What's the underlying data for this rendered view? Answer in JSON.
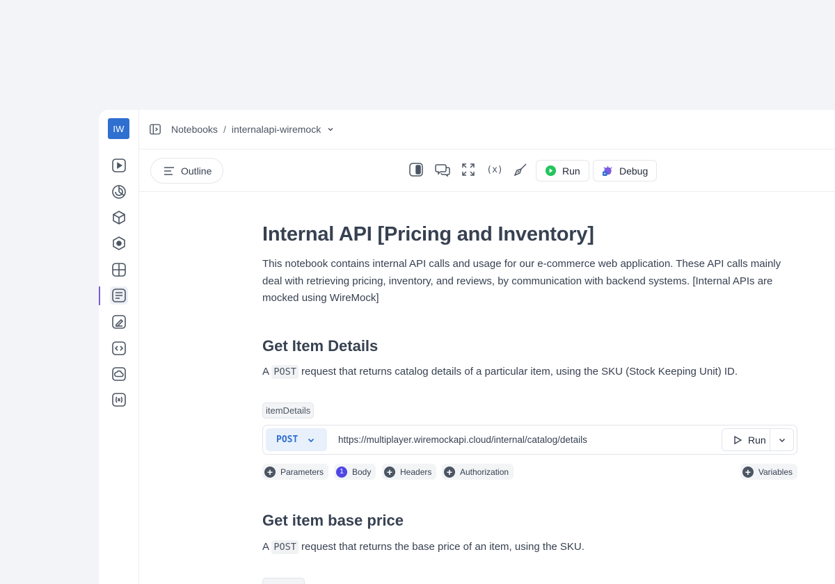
{
  "user": {
    "initials": "IW"
  },
  "breadcrumb": {
    "root": "Notebooks",
    "separator": "/",
    "current": "internalapi-wiremock"
  },
  "toolbar": {
    "outline_label": "Outline",
    "run_label": "Run",
    "debug_label": "Debug",
    "variables_glyph": "(x)"
  },
  "rail": {
    "icons": [
      "play-icon",
      "chart-icon",
      "cube-icon",
      "hexagon-icon",
      "dashboard-icon",
      "notebook-icon",
      "sketch-icon",
      "code-icon",
      "cloud-icon",
      "variables-icon"
    ],
    "active": "notebook-icon"
  },
  "notebook": {
    "title": "Internal API [Pricing and Inventory]",
    "intro": "This notebook contains internal API calls and usage for our e-commerce web application. These API calls mainly deal with retrieving pricing, inventory, and reviews, by communication with backend systems. [Internal APIs are mocked using WireMock]",
    "sections": [
      {
        "heading": "Get Item Details",
        "desc_prefix": "A",
        "desc_code": "POST",
        "desc_suffix": "request that returns catalog details of a particular item, using the SKU (Stock Keeping Unit) ID.",
        "cell": {
          "tag": "itemDetails",
          "method": "POST",
          "url": "https://multiplayer.wiremockapi.cloud/internal/catalog/details",
          "run_label": "Run",
          "chips": {
            "parameters": "Parameters",
            "body": "Body",
            "body_count": "1",
            "headers": "Headers",
            "authorization": "Authorization",
            "variables": "Variables"
          }
        }
      },
      {
        "heading": "Get item base price",
        "desc_prefix": "A",
        "desc_code": "POST",
        "desc_suffix": "request that returns the base price of an item, using the SKU."
      }
    ]
  },
  "colors": {
    "accent": "#2f6fd0",
    "active_rail": "#7b5bd6",
    "run_green": "#22c55e",
    "body_badge": "#4f46e5"
  }
}
